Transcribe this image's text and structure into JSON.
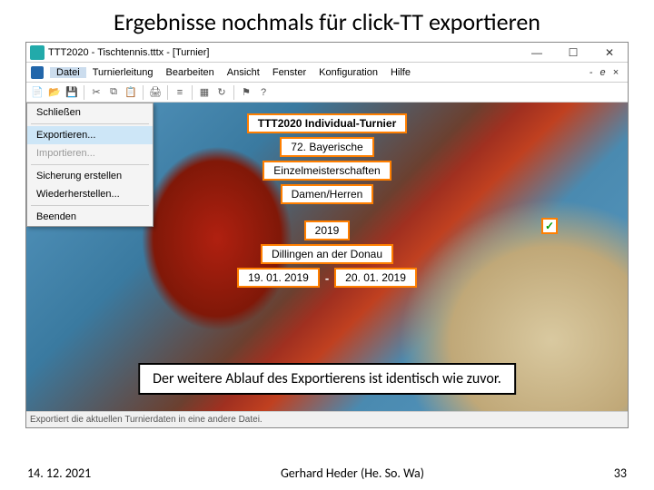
{
  "slide": {
    "title": "Ergebnisse nochmals für click-TT exportieren",
    "note": "Der weitere Ablauf des Exportierens ist identisch wie zuvor.",
    "footer_date": "14. 12. 2021",
    "footer_author": "Gerhard Heder (He. So. Wa)",
    "footer_page": "33"
  },
  "window": {
    "title": "TTT2020 - Tischtennis.tttx - [Turnier]",
    "controls": {
      "min": "—",
      "max": "☐",
      "close": "✕"
    }
  },
  "menubar": {
    "items": [
      "Datei",
      "Turnierleitung",
      "Bearbeiten",
      "Ansicht",
      "Fenster",
      "Konfiguration",
      "Hilfe"
    ],
    "right": [
      "-",
      "e",
      "×"
    ]
  },
  "dropdown": {
    "items": [
      {
        "label": "Schließen",
        "state": ""
      },
      {
        "sep": true
      },
      {
        "label": "Exportieren...",
        "state": "hover"
      },
      {
        "label": "Importieren...",
        "state": "disabled"
      },
      {
        "sep": true
      },
      {
        "label": "Sicherung erstellen",
        "state": ""
      },
      {
        "label": "Wiederherstellen...",
        "state": ""
      },
      {
        "sep": true
      },
      {
        "label": "Beenden",
        "state": ""
      }
    ]
  },
  "form": {
    "title": "TTT2020 Individual-Turnier",
    "line1": "72. Bayerische",
    "line2": "Einzelmeisterschaften",
    "line3": "Damen/Herren",
    "year": "2019",
    "location": "Dillingen an der Donau",
    "date1": "19. 01. 2019",
    "date_sep": "-",
    "date2": "20. 01. 2019",
    "check": "✓"
  },
  "statusbar": {
    "text": "Exportiert die aktuellen Turnierdaten in eine andere Datei."
  }
}
